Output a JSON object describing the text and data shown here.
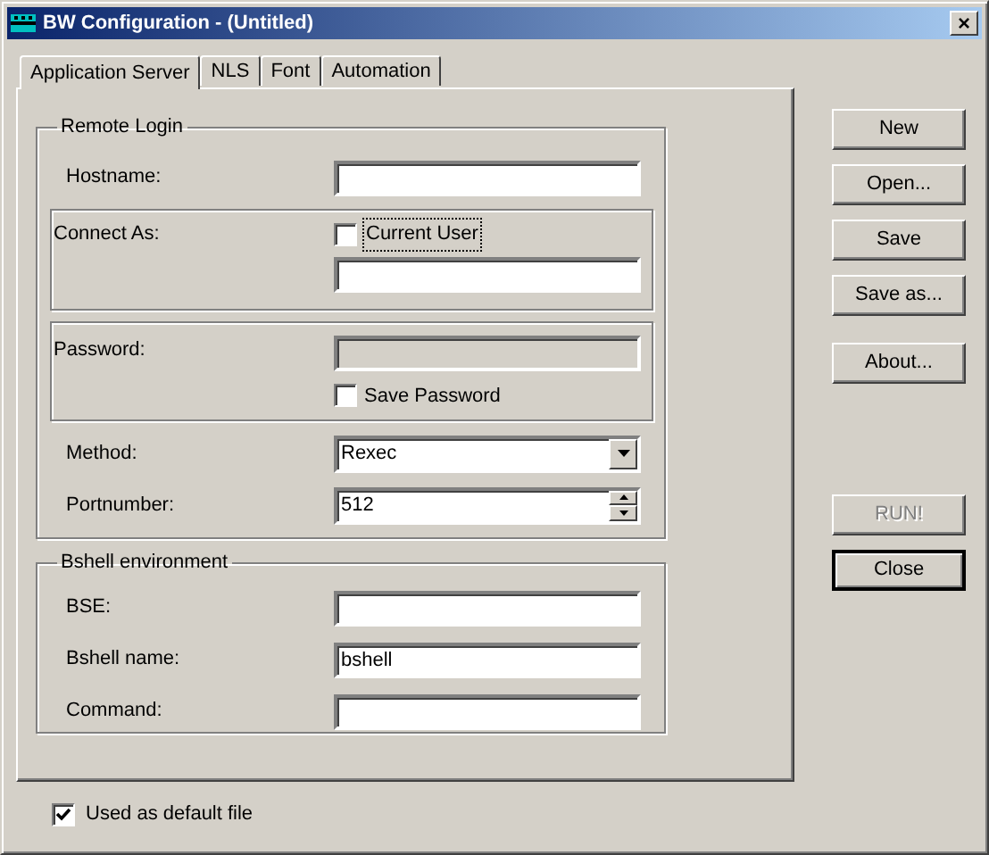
{
  "window": {
    "title": "BW Configuration - (Untitled)",
    "close": "×"
  },
  "tabs": [
    {
      "label": "Application Server",
      "selected": true
    },
    {
      "label": "NLS",
      "selected": false
    },
    {
      "label": "Font",
      "selected": false
    },
    {
      "label": "Automation",
      "selected": false
    }
  ],
  "remote_login": {
    "title": "Remote Login",
    "hostname": {
      "label": "Hostname:"
    },
    "connect_as": {
      "label": "Connect As:",
      "current_user": {
        "label": "Current User",
        "checked": false,
        "focused": true
      }
    },
    "password": {
      "label": "Password:",
      "disabled": true,
      "save_password": {
        "label": "Save Password",
        "checked": false
      }
    },
    "method": {
      "label": "Method:",
      "value": "Rexec"
    },
    "portnumber": {
      "label": "Portnumber:",
      "value": "512"
    }
  },
  "bshell_environment": {
    "title": "Bshell environment",
    "fields": [
      {
        "label": "BSE:"
      },
      {
        "label": "Bshell name:",
        "value": "bshell"
      },
      {
        "label": "Command:"
      }
    ]
  },
  "default_file": {
    "label": "Used as default file",
    "checked": true
  },
  "button_groups": [
    {
      "buttons": [
        {
          "label": "New",
          "disabled": false,
          "default": false
        },
        {
          "label": "Open...",
          "disabled": false,
          "default": false
        },
        {
          "label": "Save",
          "disabled": false,
          "default": false
        },
        {
          "label": "Save as...",
          "disabled": false,
          "default": false
        }
      ]
    },
    {
      "buttons": [
        {
          "label": "About...",
          "disabled": false,
          "default": false
        }
      ]
    },
    {
      "buttons": [
        {
          "label": "RUN!",
          "disabled": true,
          "default": false
        },
        {
          "label": "Close",
          "disabled": false,
          "default": true
        }
      ]
    }
  ]
}
